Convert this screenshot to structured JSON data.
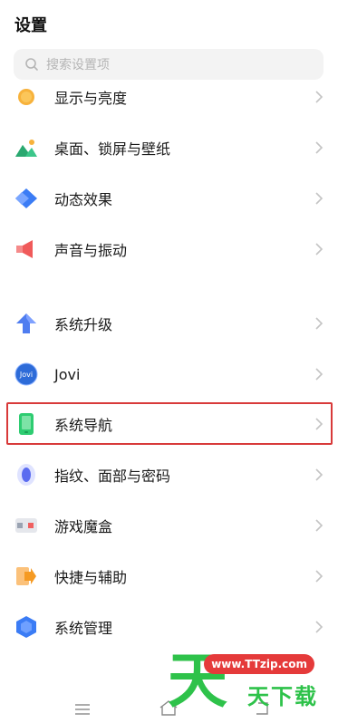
{
  "header": {
    "title": "设置"
  },
  "search": {
    "placeholder": "搜索设置项"
  },
  "items": [
    {
      "label": "显示与亮度",
      "icon": "display-brightness-icon",
      "color": "#f7b23b"
    },
    {
      "label": "桌面、锁屏与壁纸",
      "icon": "wallpaper-icon",
      "color": "#3cc68a"
    },
    {
      "label": "动态效果",
      "icon": "dynamic-effects-icon",
      "color": "#3b7cf5"
    },
    {
      "label": "声音与振动",
      "icon": "sound-vibration-icon",
      "color": "#f05a5a"
    },
    {
      "label": "系统升级",
      "icon": "system-upgrade-icon",
      "color": "#4f7df0"
    },
    {
      "label": "Jovi",
      "icon": "jovi-icon",
      "color": "#2d6bd8"
    },
    {
      "label": "系统导航",
      "icon": "system-navigation-icon",
      "color": "#2ecc71"
    },
    {
      "label": "指纹、面部与密码",
      "icon": "fingerprint-icon",
      "color": "#5b6cf0"
    },
    {
      "label": "游戏魔盒",
      "icon": "game-box-icon",
      "color": "#f06060"
    },
    {
      "label": "快捷与辅助",
      "icon": "shortcut-assist-icon",
      "color": "#f59a23"
    },
    {
      "label": "系统管理",
      "icon": "system-management-icon",
      "color": "#3b7cf5"
    }
  ],
  "watermark": {
    "url": "www.TTzip.com",
    "big": "天",
    "sub": "天下载"
  }
}
